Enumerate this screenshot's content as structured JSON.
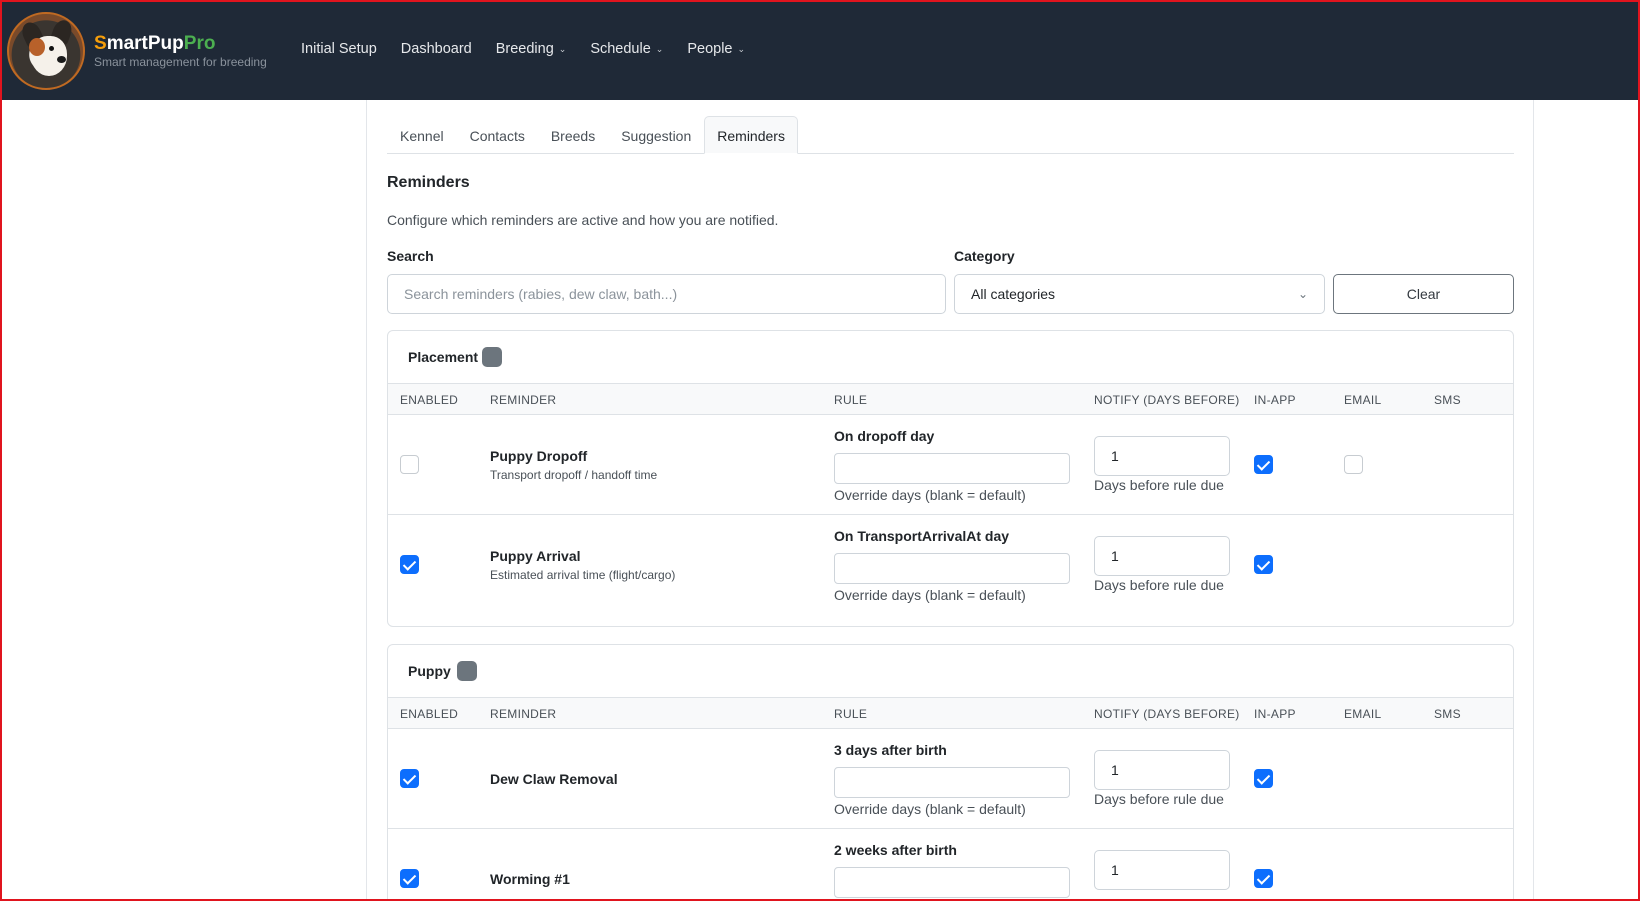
{
  "brand": {
    "name_part1": "S",
    "name_part2": "martPup",
    "name_part3": "Pro",
    "tagline": "Smart management for breeding"
  },
  "nav": {
    "items": [
      {
        "label": "Initial Setup",
        "dropdown": false
      },
      {
        "label": "Dashboard",
        "dropdown": false
      },
      {
        "label": "Breeding",
        "dropdown": true
      },
      {
        "label": "Schedule",
        "dropdown": true
      },
      {
        "label": "People",
        "dropdown": true
      }
    ]
  },
  "tabs": [
    "Kennel",
    "Contacts",
    "Breeds",
    "Suggestion",
    "Reminders"
  ],
  "active_tab": "Reminders",
  "section": {
    "title": "Reminders",
    "description": "Configure which reminders are active and how you are notified."
  },
  "filters": {
    "search_label": "Search",
    "search_placeholder": "Search reminders (rabies, dew claw, bath...)",
    "search_value": "",
    "category_label": "Category",
    "category_value": "All categories",
    "clear_label": "Clear"
  },
  "columns": {
    "enabled": "Enabled",
    "reminder": "Reminder",
    "rule": "Rule",
    "notify": "Notify (days before)",
    "inapp": "In-App",
    "email": "Email",
    "sms": "SMS"
  },
  "common": {
    "override_help": "Override days (blank = default)",
    "days_help": "Days before rule due"
  },
  "groups": [
    {
      "name": "Placement",
      "rows": [
        {
          "enabled": false,
          "name": "Puppy Dropoff",
          "sub": "Transport dropoff / handoff time",
          "rule": "On dropoff day",
          "override": "",
          "notify": "1",
          "inapp": true,
          "email": false,
          "email_shown": true
        },
        {
          "enabled": true,
          "name": "Puppy Arrival",
          "sub": "Estimated arrival time (flight/cargo)",
          "rule": "On TransportArrivalAt day",
          "override": "",
          "notify": "1",
          "inapp": true,
          "email": false,
          "email_shown": false
        }
      ]
    },
    {
      "name": "Puppy",
      "rows": [
        {
          "enabled": true,
          "name": "Dew Claw Removal",
          "sub": "",
          "rule": "3 days after birth",
          "override": "",
          "notify": "1",
          "inapp": true,
          "email": false,
          "email_shown": false
        },
        {
          "enabled": true,
          "name": "Worming #1",
          "sub": "",
          "rule": "2 weeks after birth",
          "override": "",
          "notify": "1",
          "inapp": true,
          "email": false,
          "email_shown": false
        }
      ]
    }
  ],
  "colors": {
    "navbar_bg": "#1f2937",
    "checkbox_on": "#0d6efd",
    "badge": "#6c757d",
    "accent_orange": "#f59e0b",
    "accent_green": "#4caf50"
  }
}
